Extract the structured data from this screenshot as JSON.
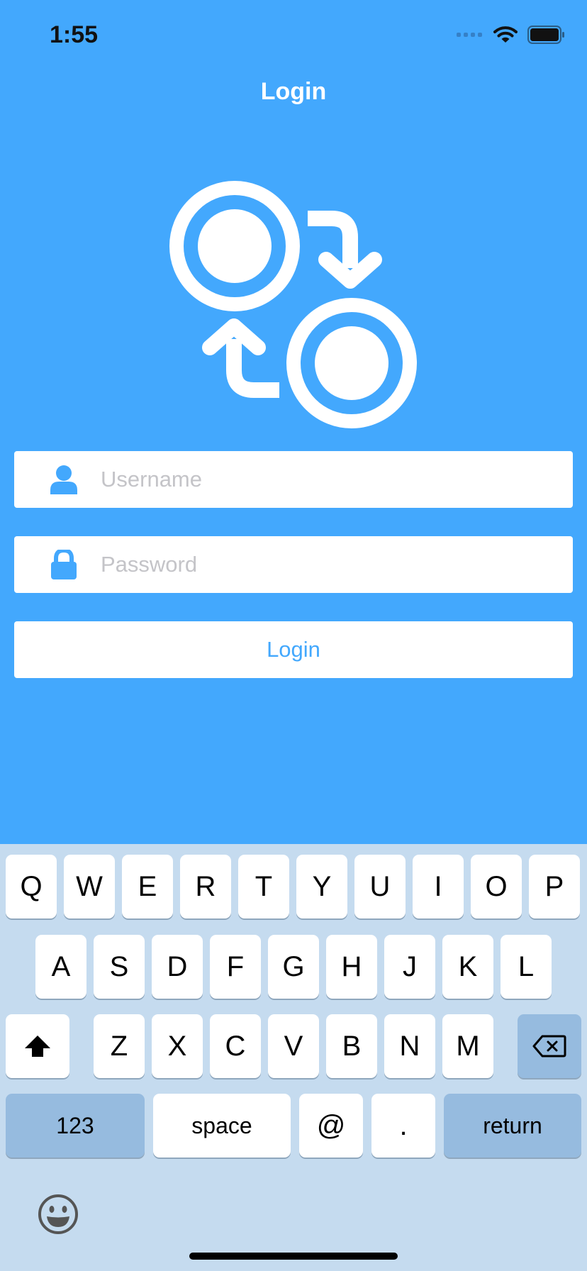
{
  "status_bar": {
    "time": "1:55"
  },
  "nav": {
    "title": "Login"
  },
  "form": {
    "username_placeholder": "Username",
    "username_value": "",
    "password_placeholder": "Password",
    "password_value": "",
    "login_label": "Login"
  },
  "keyboard": {
    "row1": [
      "Q",
      "W",
      "E",
      "R",
      "T",
      "Y",
      "U",
      "I",
      "O",
      "P"
    ],
    "row2": [
      "A",
      "S",
      "D",
      "F",
      "G",
      "H",
      "J",
      "K",
      "L"
    ],
    "row3": [
      "Z",
      "X",
      "C",
      "V",
      "B",
      "N",
      "M"
    ],
    "numbers_label": "123",
    "space_label": "space",
    "at_label": "@",
    "dot_label": ".",
    "return_label": "return"
  },
  "icons": {
    "logo": "sync-swap-logo-icon",
    "username": "person-icon",
    "password": "lock-icon",
    "shift": "shift-icon",
    "delete": "backspace-icon",
    "emoji": "emoji-icon"
  },
  "colors": {
    "background": "#43a8fd",
    "accent": "#43a8fd",
    "keyboard_bg": "#c5dbef",
    "key_dark": "#96bbdf",
    "placeholder": "#c4c4c8"
  }
}
